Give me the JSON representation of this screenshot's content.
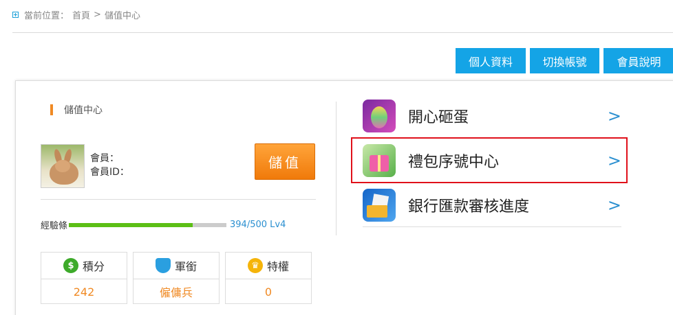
{
  "breadcrumb": {
    "label": "當前位置：",
    "home": "首頁",
    "separator": ">",
    "current": "儲值中心"
  },
  "top_buttons": [
    "個人資料",
    "切換帳號",
    "會員說明"
  ],
  "section": {
    "title": "儲值中心"
  },
  "member": {
    "name_label": "會員：",
    "id_label": "會員ID：",
    "charge_button": "儲值"
  },
  "experience": {
    "label": "經驗條",
    "value_text": "394/500 Lv4",
    "current": 394,
    "max": 500,
    "bar_color": "#5cbf15"
  },
  "stats": [
    {
      "label": "積分",
      "value": "242",
      "icon": "dollar-coin-icon",
      "icon_glyph": "$"
    },
    {
      "label": "軍銜",
      "value": "僱傭兵",
      "icon": "shield-badge-icon",
      "icon_glyph": ""
    },
    {
      "label": "特權",
      "value": "0",
      "icon": "crown-icon",
      "icon_glyph": "♛"
    }
  ],
  "menu": [
    {
      "label": "開心砸蛋",
      "arrow": ">",
      "icon": "egg-hammer-icon"
    },
    {
      "label": "禮包序號中心",
      "arrow": ">",
      "icon": "gift-box-icon",
      "highlighted": true
    },
    {
      "label": "銀行匯款審核進度",
      "arrow": ">",
      "icon": "bank-card-icon"
    }
  ],
  "colors": {
    "accent_blue": "#14a4e6",
    "orange": "#f08a24",
    "highlight_red": "#e0101a"
  }
}
